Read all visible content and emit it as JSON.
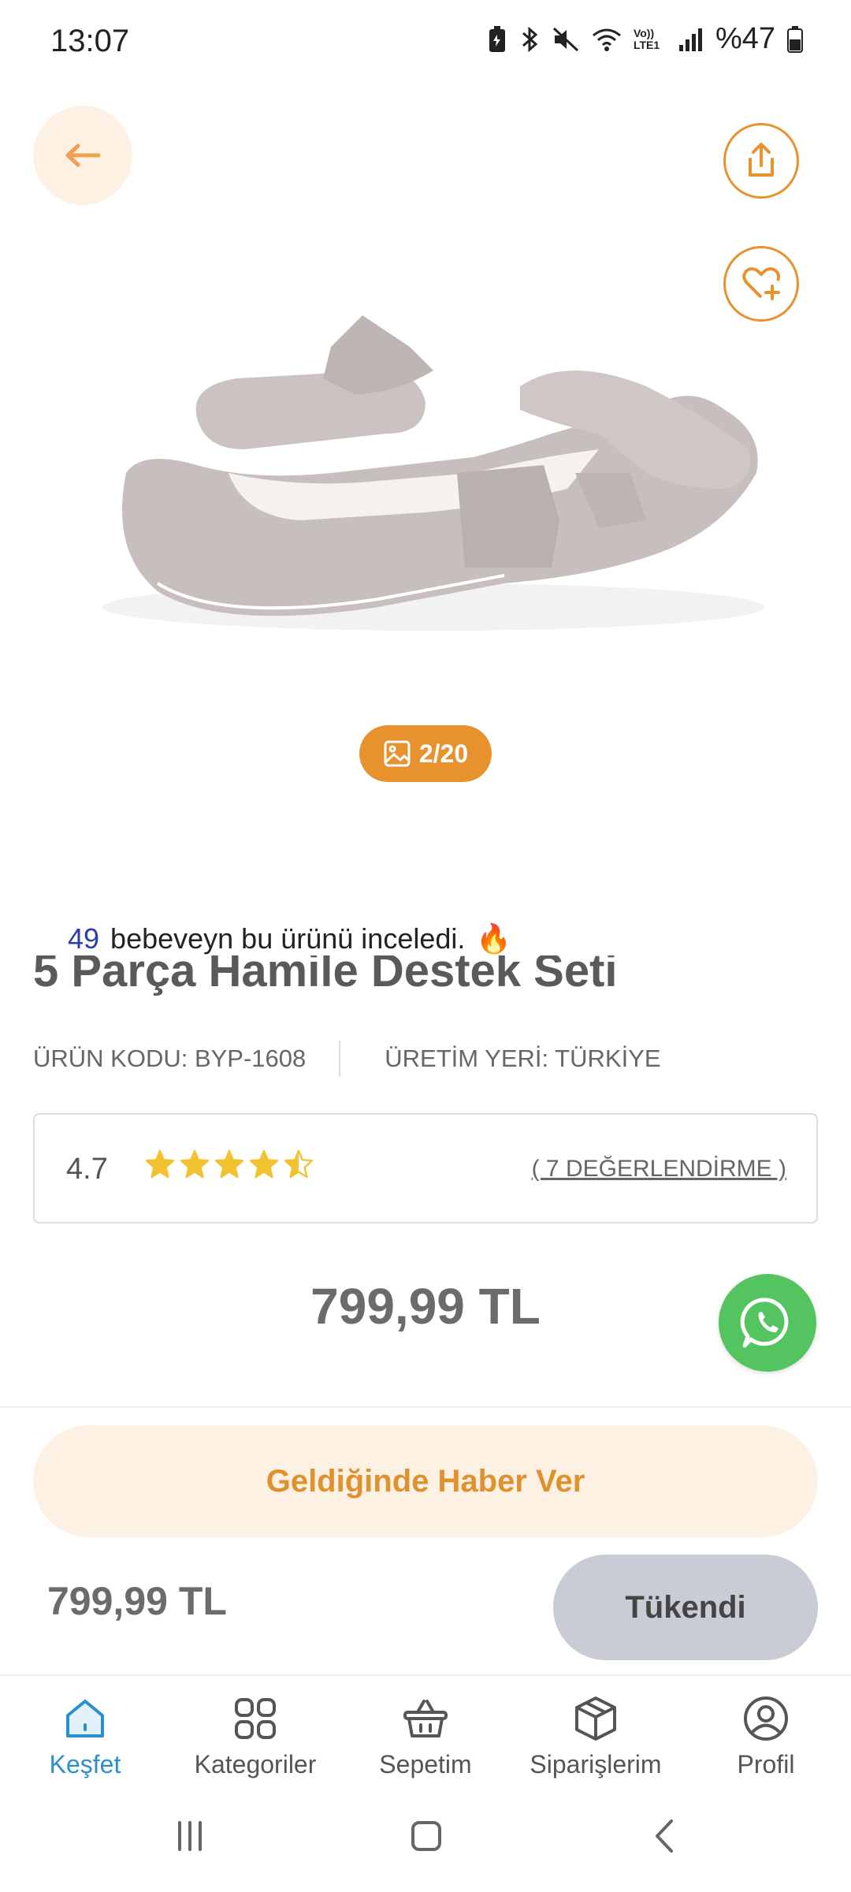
{
  "status_bar": {
    "time": "13:07",
    "battery": "%47",
    "icons": [
      "battery-saver-icon",
      "bluetooth-icon",
      "mute-icon",
      "wifi-icon",
      "volte-icon",
      "signal-icon",
      "battery-icon"
    ],
    "volte_label": "Vo)) LTE1"
  },
  "header": {
    "back_icon": "arrow-left-icon",
    "share_icon": "share-icon",
    "favorite_icon": "heart-plus-icon"
  },
  "gallery": {
    "counter": "2/20",
    "counter_icon": "image-icon"
  },
  "product": {
    "viewers_count": "49",
    "viewers_text": "bebeveyn bu ürünü inceledi.",
    "viewers_emoji": "🔥",
    "title_partial": "5 Parça Hamile Destek Seti",
    "code_label": "ÜRÜN KODU: BYP-1608",
    "origin_label": "ÜRETİM YERİ: TÜRKİYE",
    "rating": "4.7",
    "rating_value": 4.7,
    "stars_max": 5,
    "reviews_link": "( 7 DEĞERLENDİRME )",
    "price": "799,99 TL"
  },
  "actions": {
    "notify_label": "Geldiğinde Haber Ver",
    "bottom_price": "799,99 TL",
    "soldout_label": "Tükendi"
  },
  "bottom_nav": [
    {
      "label": "Keşfet",
      "icon": "home-icon",
      "active": true
    },
    {
      "label": "Kategoriler",
      "icon": "grid-icon",
      "active": false
    },
    {
      "label": "Sepetim",
      "icon": "basket-icon",
      "active": false
    },
    {
      "label": "Siparişlerim",
      "icon": "box-icon",
      "active": false
    },
    {
      "label": "Profil",
      "icon": "user-icon",
      "active": false
    }
  ],
  "colors": {
    "accent": "#e8922e",
    "accent_light": "#fcf1e2",
    "nav_active": "#2b8fcf",
    "whatsapp": "#53c45f",
    "star": "#f2c230",
    "soldout_bg": "#c9ccd4"
  }
}
